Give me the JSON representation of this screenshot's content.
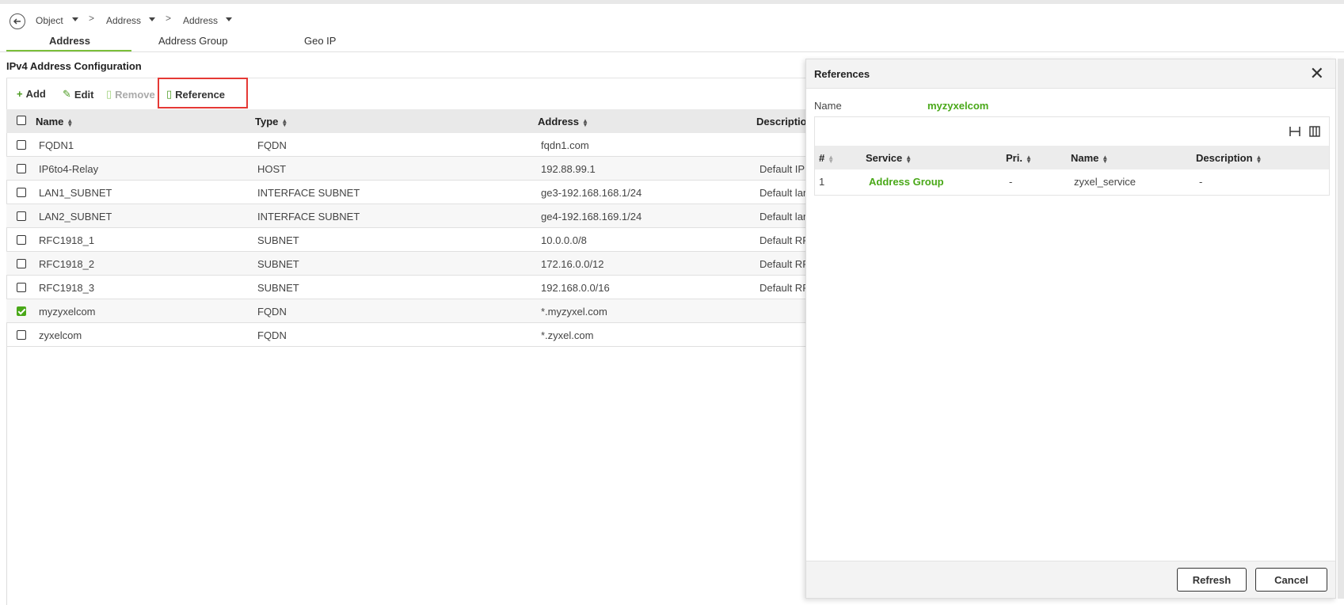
{
  "breadcrumb": {
    "item1": "Object",
    "item2": "Address",
    "item3": "Address",
    "sep": ">"
  },
  "tabs": [
    {
      "label": "Address"
    },
    {
      "label": "Address Group"
    },
    {
      "label": "Geo IP"
    }
  ],
  "section_title": "IPv4 Address Configuration",
  "toolbar": {
    "add": "Add",
    "edit": "Edit",
    "remove": "Remove",
    "reference": "Reference",
    "add_icon": "+",
    "edit_icon": "✎",
    "remove_icon": "▯",
    "reference_icon": "▯"
  },
  "table": {
    "headers": {
      "name": "Name",
      "type": "Type",
      "address": "Address",
      "description": "Descriptio"
    },
    "rows": [
      {
        "name": "FQDN1",
        "type": "FQDN",
        "address": "fqdn1.com",
        "description": ""
      },
      {
        "name": "IP6to4-Relay",
        "type": "HOST",
        "address": "192.88.99.1",
        "description": "Default IP"
      },
      {
        "name": "LAN1_SUBNET",
        "type": "INTERFACE SUBNET",
        "address": "ge3-192.168.168.1/24",
        "description": "Default lan"
      },
      {
        "name": "LAN2_SUBNET",
        "type": "INTERFACE SUBNET",
        "address": "ge4-192.168.169.1/24",
        "description": "Default lan"
      },
      {
        "name": "RFC1918_1",
        "type": "SUBNET",
        "address": "10.0.0.0/8",
        "description": "Default RF"
      },
      {
        "name": "RFC1918_2",
        "type": "SUBNET",
        "address": "172.16.0.0/12",
        "description": "Default RF"
      },
      {
        "name": "RFC1918_3",
        "type": "SUBNET",
        "address": "192.168.0.0/16",
        "description": "Default RF"
      },
      {
        "name": "myzyxelcom",
        "type": "FQDN",
        "address": "*.myzyxel.com",
        "description": ""
      },
      {
        "name": "zyxelcom",
        "type": "FQDN",
        "address": "*.zyxel.com",
        "description": ""
      }
    ]
  },
  "panel": {
    "title": "References",
    "name_label": "Name",
    "name_value": "myzyxelcom",
    "headers": {
      "num": "#",
      "service": "Service",
      "pri": "Pri.",
      "name": "Name",
      "description": "Description"
    },
    "rows": [
      {
        "num": "1",
        "service": "Address Group",
        "pri": "-",
        "name": "zyxel_service",
        "description": "-"
      }
    ],
    "refresh": "Refresh",
    "cancel": "Cancel"
  },
  "colors": {
    "accent": "#49a818",
    "highlight": "#e53935"
  }
}
